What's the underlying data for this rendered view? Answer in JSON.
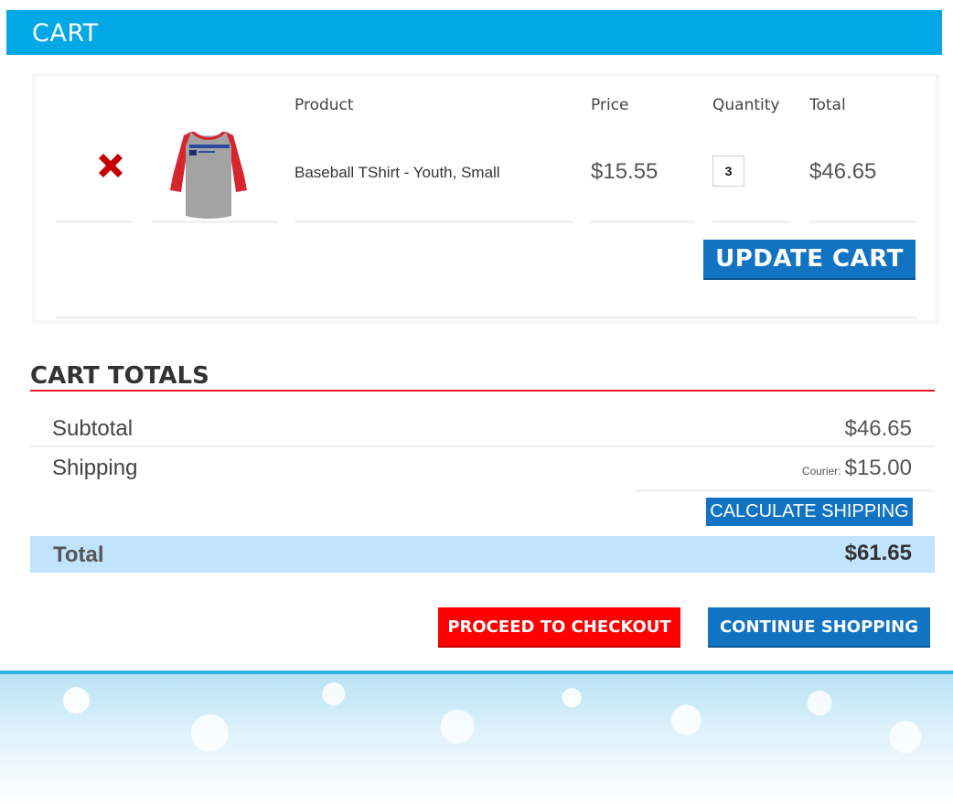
{
  "header": {
    "title": "CART"
  },
  "cart_table": {
    "columns": {
      "product": "Product",
      "price": "Price",
      "quantity": "Quantity",
      "total": "Total"
    },
    "items": [
      {
        "name": "Baseball TShirt - Youth, Small",
        "price": "$15.55",
        "quantity": "3",
        "total": "$46.65",
        "thumbnail_icon": "raglan-tshirt-image"
      }
    ],
    "remove_icon": "remove-x-icon",
    "update_label": "UPDATE CART"
  },
  "cart_totals": {
    "title": "CART TOTALS",
    "subtotal_label": "Subtotal",
    "subtotal_value": "$46.65",
    "shipping_label": "Shipping",
    "shipping_method": "Courier:",
    "shipping_value": "$15.00",
    "calc_shipping_label": "CALCULATE SHIPPING",
    "total_label": "Total",
    "total_value": "$61.65"
  },
  "actions": {
    "checkout_label": "PROCEED TO CHECKOUT",
    "continue_label": "CONTINUE SHOPPING"
  },
  "colors": {
    "header_bg": "#00a8e6",
    "button_blue": "#1273c3",
    "checkout_red": "#ff0000",
    "totals_rule": "#e8171f",
    "total_row_bg": "#c1e3fb",
    "remove_red": "#c50000"
  }
}
